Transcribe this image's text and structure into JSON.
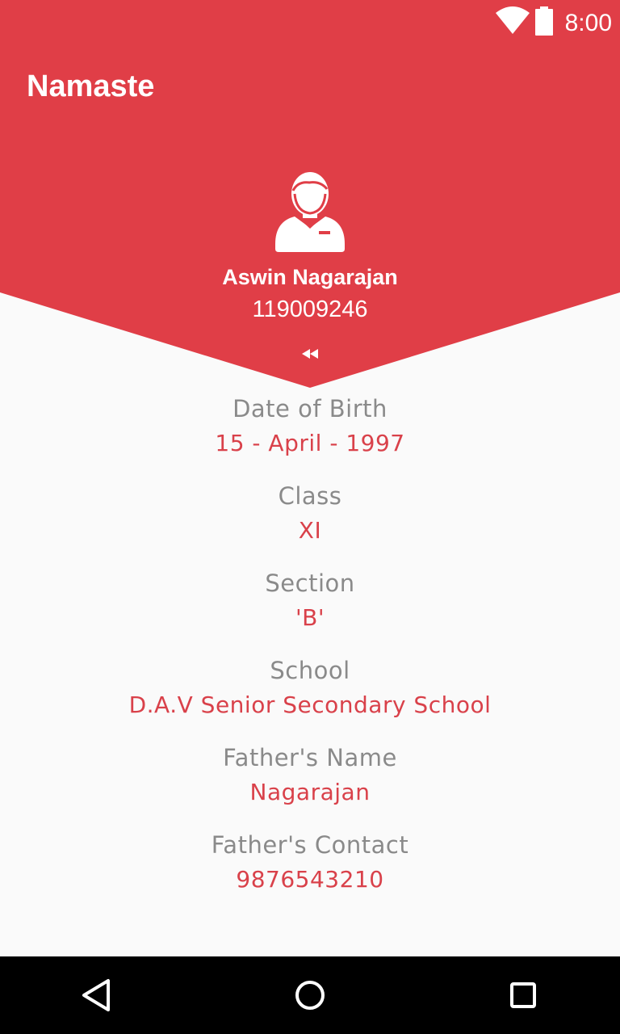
{
  "colors": {
    "primary": "#e03e47",
    "label": "#8a8a8a",
    "value": "#d9414a",
    "background": "#fafafa"
  },
  "status_bar": {
    "time": "8:00",
    "icons": [
      "wifi-icon",
      "battery-icon"
    ]
  },
  "app_bar": {
    "title": "Namaste"
  },
  "profile": {
    "avatar_icon": "person-avatar-icon",
    "name": "Aswin Nagarajan",
    "id": "119009246",
    "toggle_icon": "rewind-collapse-icon"
  },
  "details": [
    {
      "label": "Date of Birth",
      "value": "15 - April - 1997"
    },
    {
      "label": "Class",
      "value": "XI"
    },
    {
      "label": "Section",
      "value": "'B'"
    },
    {
      "label": "School",
      "value": "D.A.V Senior Secondary School"
    },
    {
      "label": "Father's Name",
      "value": "Nagarajan"
    },
    {
      "label": "Father's Contact",
      "value": "9876543210"
    }
  ],
  "nav_bar": {
    "icons": [
      "back-icon",
      "home-icon",
      "recents-icon"
    ]
  }
}
